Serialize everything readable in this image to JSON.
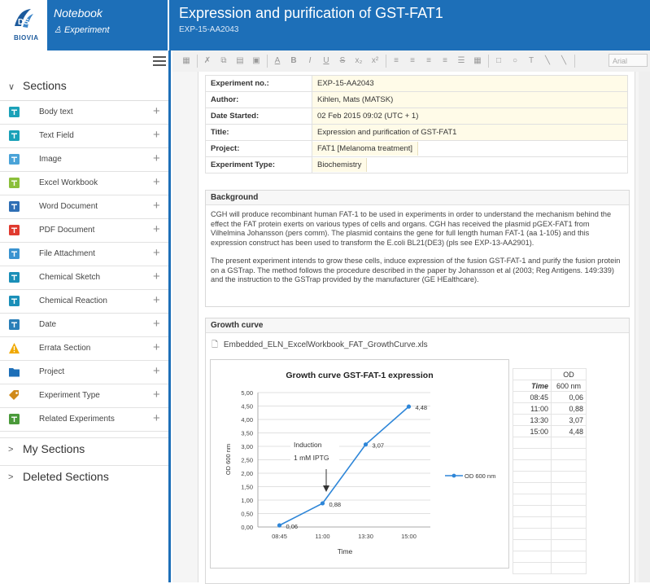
{
  "app": {
    "logo_text": "DS",
    "logo_sub": "BIOVIA",
    "notebook_label": "Notebook",
    "experiment_label": "Experiment"
  },
  "document": {
    "title": "Expression and purification of GST-FAT1",
    "id": "EXP-15-AA2043"
  },
  "sidebar": {
    "sections_label": "Sections",
    "my_sections_label": "My Sections",
    "deleted_sections_label": "Deleted Sections",
    "items": [
      {
        "label": "Body text",
        "icon": "body-text-icon",
        "color": "#1aa1b8"
      },
      {
        "label": "Text Field",
        "icon": "text-field-icon",
        "color": "#1aa1b8"
      },
      {
        "label": "Image",
        "icon": "image-icon",
        "color": "#4aa3d8"
      },
      {
        "label": "Excel Workbook",
        "icon": "excel-icon",
        "color": "#8bbf3a"
      },
      {
        "label": "Word Document",
        "icon": "word-icon",
        "color": "#2f6fb5"
      },
      {
        "label": "PDF Document",
        "icon": "pdf-icon",
        "color": "#e03a2f"
      },
      {
        "label": "File Attachment",
        "icon": "file-attachment-icon",
        "color": "#3a93d0"
      },
      {
        "label": "Chemical Sketch",
        "icon": "chemical-sketch-icon",
        "color": "#1a8fb8"
      },
      {
        "label": "Chemical Reaction",
        "icon": "chemical-reaction-icon",
        "color": "#1a8fb8"
      },
      {
        "label": "Date",
        "icon": "date-icon",
        "color": "#2a7fb8"
      },
      {
        "label": "Errata Section",
        "icon": "warning-icon",
        "color": "#f0a800"
      },
      {
        "label": "Project",
        "icon": "folder-icon",
        "color": "#1d6fb8"
      },
      {
        "label": "Experiment Type",
        "icon": "tag-icon",
        "color": "#d08a1a"
      },
      {
        "label": "Related Experiments",
        "icon": "related-icon",
        "color": "#4a9a3a"
      }
    ]
  },
  "toolbar": {
    "font_select": "Arial"
  },
  "metadata": {
    "rows": [
      {
        "key": "Experiment no.:",
        "value": "EXP-15-AA2043",
        "short": false
      },
      {
        "key": "Author:",
        "value": "Kihlen, Mats (MATSK)",
        "short": false
      },
      {
        "key": "Date Started:",
        "value": "02 Feb 2015 09:02 (UTC + 1)",
        "short": false
      },
      {
        "key": "Title:",
        "value": "Expression and purification of GST-FAT1",
        "short": false
      },
      {
        "key": "Project:",
        "value": "FAT1 [Melanoma treatment]",
        "short": true
      },
      {
        "key": "Experiment Type:",
        "value": "Biochemistry",
        "short": true
      }
    ]
  },
  "background": {
    "heading": "Background",
    "p1": "CGH will produce recombinant human FAT-1 to be used in experiments in order to understand the mechanism behind the effect the FAT protein exerts on various types of cells and organs. CGH has received the plasmid pGEX-FAT1 from Vilhelmina Johansson (pers comm). The plasmid contains the gene for full length human FAT-1 (aa 1-105) and this expression construct has been used to transform the E.coli BL21(DE3) (pls see EXP-13-AA2901).",
    "p2": "The present experiment intends to grow these cells, induce expression of the fusion GST-FAT-1 and purify the fusion protein on a GSTrap. The method follows the procedure described in the paper by Johansson et al (2003; Reg Antigens. 149:339) and the instruction to the GSTrap provided by the manufacturer (GE HEalthcare)."
  },
  "growth": {
    "heading": "Growth curve",
    "file_name": "Embedded_ELN_ExcelWorkbook_FAT_GrowthCurve.xls",
    "table_header_time": "Time",
    "table_header_od": "OD",
    "table_header_od_unit": "600 nm",
    "table_rows": [
      {
        "time": "08:45",
        "od": "0,06"
      },
      {
        "time": "11:00",
        "od": "0,88"
      },
      {
        "time": "13:30",
        "od": "3,07"
      },
      {
        "time": "15:00",
        "od": "4,48"
      }
    ]
  },
  "chart_data": {
    "type": "line",
    "title": "Growth curve GST-FAT-1 expression",
    "xlabel": "Time",
    "ylabel": "OD 600 nm",
    "categories": [
      "08:45",
      "11:00",
      "13:30",
      "15:00"
    ],
    "series": [
      {
        "name": "OD 600 nm",
        "values": [
          0.06,
          0.88,
          3.07,
          4.48
        ],
        "color": "#2e86d8"
      }
    ],
    "data_labels": [
      "0,06",
      "0,88",
      "3,07",
      "4,48"
    ],
    "yticks": [
      "0,00",
      "0,50",
      "1,00",
      "1,50",
      "2,00",
      "2,50",
      "3,00",
      "3,50",
      "4,00",
      "4,50",
      "5,00"
    ],
    "ylim": [
      0,
      5
    ],
    "annotation": {
      "line1": "Induction",
      "line2": "1 mM IPTG"
    },
    "legend_position": "right",
    "grid": true
  }
}
